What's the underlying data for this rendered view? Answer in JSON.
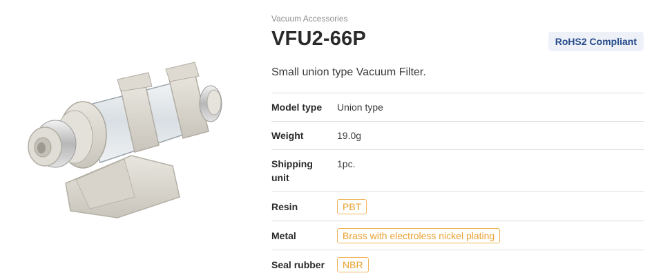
{
  "product": {
    "category": "Vacuum Accessories",
    "title": "VFU2-66P",
    "badge": "RoHS2 Compliant",
    "description": "Small union type Vacuum Filter.",
    "image_alt": "vacuum-filter-product-image"
  },
  "specs": [
    {
      "label": "Model type",
      "value": "Union type",
      "tag": false
    },
    {
      "label": "Weight",
      "value": "19.0g",
      "tag": false
    },
    {
      "label": "Shipping unit",
      "value": "1pc.",
      "tag": false
    },
    {
      "label": "Resin",
      "value": "PBT",
      "tag": true
    },
    {
      "label": "Metal",
      "value": "Brass with electroless nickel plating",
      "tag": true
    },
    {
      "label": "Seal rubber",
      "value": "NBR",
      "tag": true
    }
  ],
  "colors": {
    "badge_bg": "#eef2f8",
    "badge_text": "#254a8a",
    "tag_border": "#f0b45a",
    "tag_text": "#e8a030"
  }
}
